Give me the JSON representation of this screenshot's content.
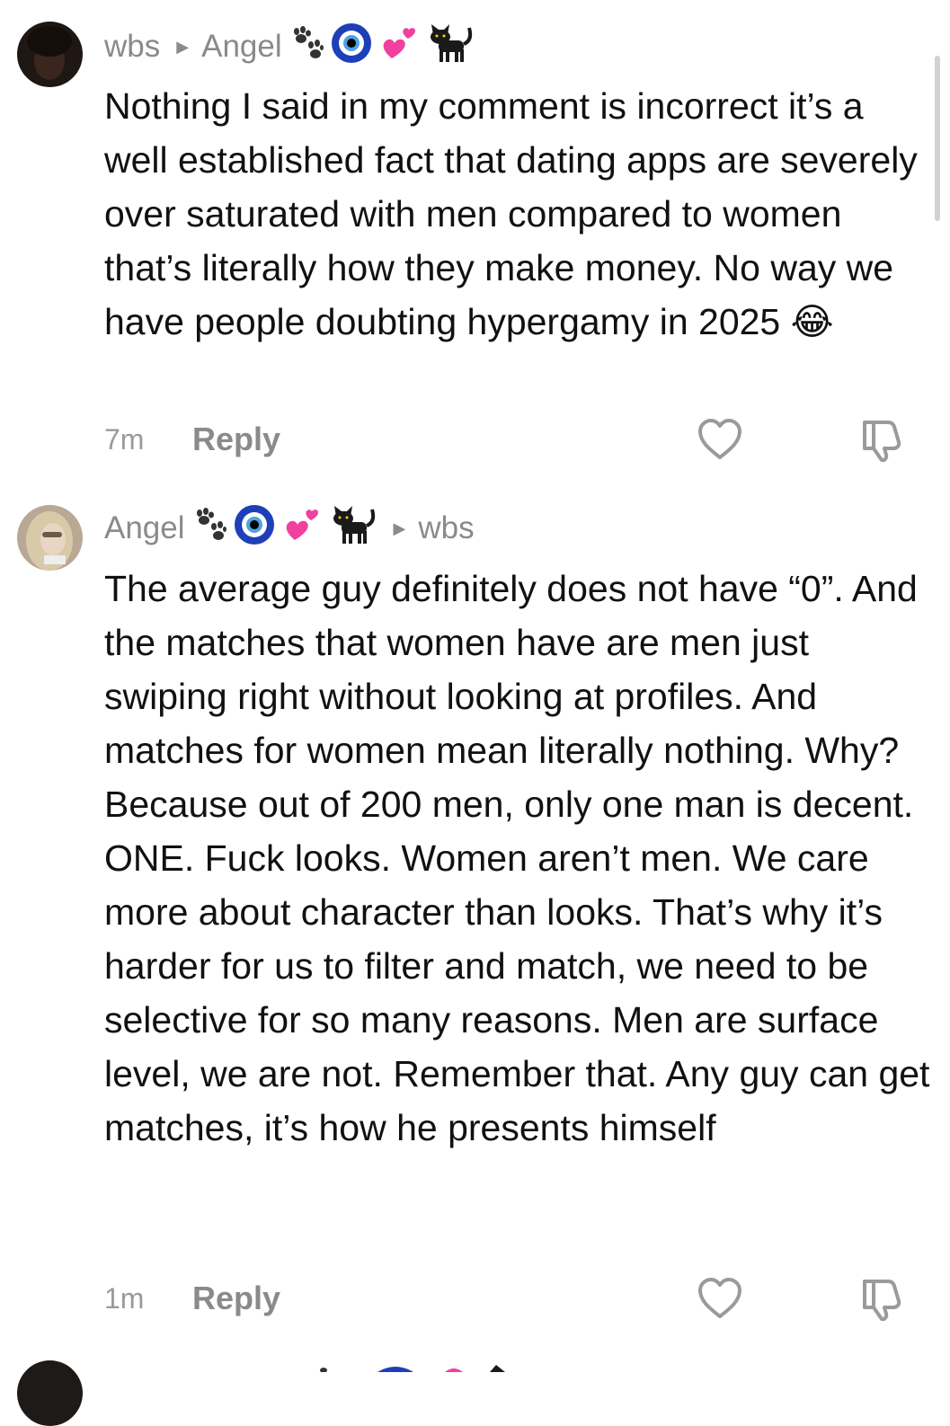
{
  "comments": [
    {
      "author": "wbs",
      "reply_to": "Angel",
      "text": "Nothing I said in my comment is incorrect it’s a well established fact that dating apps are severely over saturated with men compared to women that’s literally how they make money. No way we have people doubting hypergamy in 2025 😂",
      "time": "7m",
      "reply_label": "Reply"
    },
    {
      "author": "Angel",
      "reply_to": "wbs",
      "text": "The average guy definitely does not have “0”. And the matches that women have are men just swiping right without looking at profiles. And matches for women mean literally nothing. Why? Because out of 200 men, only one man is decent. ONE. Fuck looks. Women aren’t men. We care more about character than looks. That’s why it’s harder for us to filter and match, we need to be selective for so many reasons. Men are surface level, we are not. Remember that. Any guy can get matches, it’s how he presents himself",
      "time": "1m",
      "reply_label": "Reply"
    }
  ],
  "icons": {
    "like": "heart-outline-icon",
    "dislike": "thumbs-down-outline-icon",
    "paw": "paw-prints-emoji",
    "evil_eye": "nazar-amulet-emoji",
    "hearts": "two-hearts-emoji",
    "cat": "black-cat-emoji",
    "laugh": "tears-of-joy-emoji"
  },
  "colors": {
    "meta_text": "#8a8a8a",
    "body_text": "#111111"
  }
}
